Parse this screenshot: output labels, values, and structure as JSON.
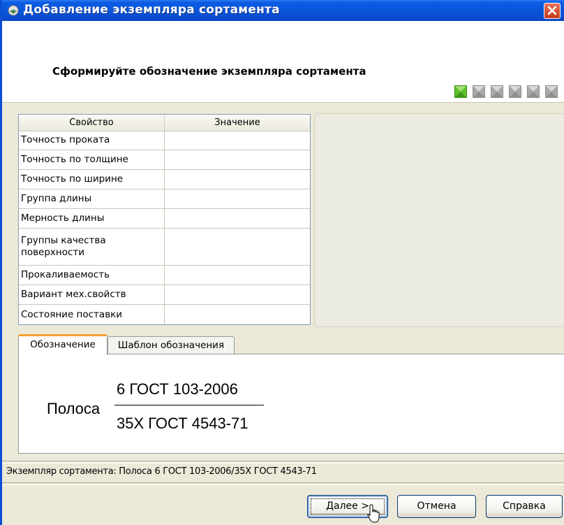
{
  "window": {
    "title": "Добавление экземпляра сортамента",
    "icon": "app-icon",
    "close_icon": "close-icon"
  },
  "header": {
    "instruction": "Сформируйте обозначение экземпляра сортамента",
    "steps": {
      "total": 6,
      "current": 1,
      "active_color": "#5fbf2a",
      "inactive_color": "#a9a9a9"
    }
  },
  "grid": {
    "columns": [
      "Свойство",
      "Значение"
    ],
    "rows": [
      {
        "name": "Точность проката",
        "value": ""
      },
      {
        "name": "Точность по толщине",
        "value": ""
      },
      {
        "name": "Точность по ширине",
        "value": ""
      },
      {
        "name": "Группа длины",
        "value": ""
      },
      {
        "name": "Мерность длины",
        "value": ""
      },
      {
        "name": "Группы качества поверхности",
        "value": ""
      },
      {
        "name": "Прокаливаемость",
        "value": ""
      },
      {
        "name": "Вариант мех.свойств",
        "value": ""
      },
      {
        "name": "Состояние поставки",
        "value": ""
      }
    ]
  },
  "tabs": [
    {
      "label": "Обозначение",
      "active": true
    },
    {
      "label": "Шаблон обозначения",
      "active": false
    }
  ],
  "designation": {
    "word": "Полоса",
    "numerator": "6 ГОСТ 103-2006",
    "denominator": "35Х ГОСТ 4543-71"
  },
  "status": "Экземпляр сортамента: Полоса 6 ГОСТ 103-2006/35Х ГОСТ 4543-71",
  "buttons": {
    "next": "Далее >",
    "cancel": "Отмена",
    "help": "Справка"
  },
  "accent": "#0a55d8"
}
